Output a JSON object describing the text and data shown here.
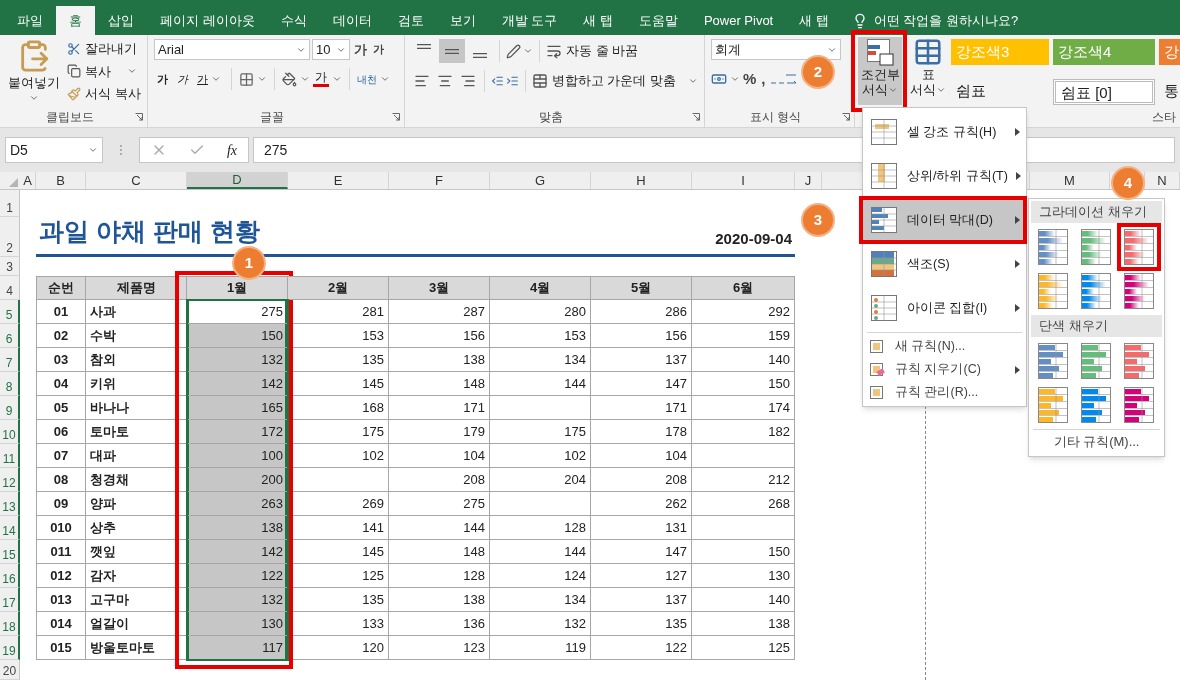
{
  "tabs": [
    {
      "label": "파일",
      "selected": false
    },
    {
      "label": "홈",
      "selected": true
    },
    {
      "label": "삽입",
      "selected": false
    },
    {
      "label": "페이지 레이아웃",
      "selected": false
    },
    {
      "label": "수식",
      "selected": false
    },
    {
      "label": "데이터",
      "selected": false
    },
    {
      "label": "검토",
      "selected": false
    },
    {
      "label": "보기",
      "selected": false
    },
    {
      "label": "개발 도구",
      "selected": false
    },
    {
      "label": "새 탭",
      "selected": false
    },
    {
      "label": "도움말",
      "selected": false
    },
    {
      "label": "Power Pivot",
      "selected": false
    },
    {
      "label": "새 탭",
      "selected": false
    }
  ],
  "tell_me": {
    "placeholder": "어떤 작업을 원하시나요?"
  },
  "ribbon": {
    "clipboard": {
      "paste": "붙여넣기",
      "cut": "잘라내기",
      "copy": "복사",
      "format_painter": "서식 복사",
      "label": "클립보드"
    },
    "font": {
      "name": "Arial",
      "size": "10",
      "grow": "가",
      "shrink": "가",
      "bold": "가",
      "italic": "가",
      "underline": "가",
      "font_color": "가",
      "phonetic": "내천",
      "label": "글꼴"
    },
    "alignment": {
      "vertical": [
        {
          "selected": false
        },
        {
          "selected": true
        },
        {
          "selected": false
        }
      ],
      "horizontal": [
        {
          "selected": false
        },
        {
          "selected": false
        },
        {
          "selected": false
        }
      ],
      "wrap_text": "자동 줄 바꿈",
      "merge": "병합하고 가운데 맞춤",
      "label": "맞춤"
    },
    "number": {
      "format": "회계",
      "percent": "%",
      "comma": ",",
      "label": "표시 형식"
    },
    "styles": {
      "conditional_formatting": {
        "line1": "조건부",
        "line2": "서식",
        "pressed": true,
        "highlighted": true
      },
      "format_as_table": {
        "line1": "표",
        "line2": "서식"
      },
      "cell_styles": [
        {
          "kind": "accent",
          "label": "강조색3",
          "color": "#ffc000"
        },
        {
          "kind": "accent",
          "label": "강조색4",
          "color": "#70ad47"
        },
        {
          "kind": "accent",
          "label": "강",
          "color": "#ed7d31"
        },
        {
          "kind": "plain",
          "label": "쉼표"
        },
        {
          "kind": "current",
          "label": "쉼표 [0]"
        },
        {
          "kind": "plain",
          "label": "통"
        }
      ],
      "label": "스타"
    }
  },
  "formula_bar": {
    "name_box": "D5",
    "function_label": "fx",
    "formula": "275"
  },
  "sheet": {
    "column_headers": [
      {
        "label": "A",
        "selected": false
      },
      {
        "label": "B",
        "selected": false
      },
      {
        "label": "C",
        "selected": false
      },
      {
        "label": "D",
        "selected": true
      },
      {
        "label": "E",
        "selected": false
      },
      {
        "label": "F",
        "selected": false
      },
      {
        "label": "G",
        "selected": false
      },
      {
        "label": "H",
        "selected": false
      },
      {
        "label": "I",
        "selected": false
      },
      {
        "label": "J",
        "selected": false
      },
      {
        "label": "M",
        "selected": false
      },
      {
        "label": "N",
        "selected": false
      }
    ],
    "row_headers": [
      {
        "label": "1",
        "selected": false
      },
      {
        "label": "2",
        "selected": false
      },
      {
        "label": "3",
        "selected": false
      },
      {
        "label": "4",
        "selected": false
      },
      {
        "label": "5",
        "selected": true
      },
      {
        "label": "6",
        "selected": true
      },
      {
        "label": "7",
        "selected": true
      },
      {
        "label": "8",
        "selected": true
      },
      {
        "label": "9",
        "selected": true
      },
      {
        "label": "10",
        "selected": true
      },
      {
        "label": "11",
        "selected": true
      },
      {
        "label": "12",
        "selected": true
      },
      {
        "label": "13",
        "selected": true
      },
      {
        "label": "14",
        "selected": true
      },
      {
        "label": "15",
        "selected": true
      },
      {
        "label": "16",
        "selected": true
      },
      {
        "label": "17",
        "selected": true
      },
      {
        "label": "18",
        "selected": true
      },
      {
        "label": "19",
        "selected": true
      },
      {
        "label": "20",
        "selected": false
      }
    ],
    "title": "과일 야채 판매 현황",
    "date": "2020-09-04",
    "header_cells": [
      {
        "label": "순번",
        "highlighted": false
      },
      {
        "label": "제품명",
        "highlighted": false
      },
      {
        "label": "1월",
        "highlighted": true
      },
      {
        "label": "2월",
        "highlighted": false
      },
      {
        "label": "3월",
        "highlighted": false
      },
      {
        "label": "4월",
        "highlighted": false
      },
      {
        "label": "5월",
        "highlighted": false
      },
      {
        "label": "6월",
        "highlighted": false
      }
    ],
    "rows": [
      {
        "no": "01",
        "name": "사과",
        "cells": [
          {
            "text": "275",
            "selected": true,
            "active": true
          },
          {
            "text": "281",
            "selected": false
          },
          {
            "text": "287",
            "selected": false
          },
          {
            "text": "280",
            "selected": false
          },
          {
            "text": "286",
            "selected": false
          },
          {
            "text": "292",
            "selected": false
          }
        ]
      },
      {
        "no": "02",
        "name": "수박",
        "cells": [
          {
            "text": "150",
            "selected": true,
            "active": false
          },
          {
            "text": "153",
            "selected": false
          },
          {
            "text": "156",
            "selected": false
          },
          {
            "text": "153",
            "selected": false
          },
          {
            "text": "156",
            "selected": false
          },
          {
            "text": "159",
            "selected": false
          }
        ]
      },
      {
        "no": "03",
        "name": "참외",
        "cells": [
          {
            "text": "132",
            "selected": true,
            "active": false
          },
          {
            "text": "135",
            "selected": false
          },
          {
            "text": "138",
            "selected": false
          },
          {
            "text": "134",
            "selected": false
          },
          {
            "text": "137",
            "selected": false
          },
          {
            "text": "140",
            "selected": false
          }
        ]
      },
      {
        "no": "04",
        "name": "키위",
        "cells": [
          {
            "text": "142",
            "selected": true,
            "active": false
          },
          {
            "text": "145",
            "selected": false
          },
          {
            "text": "148",
            "selected": false
          },
          {
            "text": "144",
            "selected": false
          },
          {
            "text": "147",
            "selected": false
          },
          {
            "text": "150",
            "selected": false
          }
        ]
      },
      {
        "no": "05",
        "name": "바나나",
        "cells": [
          {
            "text": "165",
            "selected": true,
            "active": false
          },
          {
            "text": "168",
            "selected": false
          },
          {
            "text": "171",
            "selected": false
          },
          {
            "selected": false
          },
          {
            "text": "171",
            "selected": false
          },
          {
            "text": "174",
            "selected": false
          }
        ]
      },
      {
        "no": "06",
        "name": "토마토",
        "cells": [
          {
            "text": "172",
            "selected": true,
            "active": false
          },
          {
            "text": "175",
            "selected": false
          },
          {
            "text": "179",
            "selected": false
          },
          {
            "text": "175",
            "selected": false
          },
          {
            "text": "178",
            "selected": false
          },
          {
            "text": "182",
            "selected": false
          }
        ]
      },
      {
        "no": "07",
        "name": "대파",
        "cells": [
          {
            "text": "100",
            "selected": true,
            "active": false
          },
          {
            "text": "102",
            "selected": false
          },
          {
            "text": "104",
            "selected": false
          },
          {
            "text": "102",
            "selected": false
          },
          {
            "text": "104",
            "selected": false
          },
          {
            "selected": false
          }
        ]
      },
      {
        "no": "08",
        "name": "청경채",
        "cells": [
          {
            "text": "200",
            "selected": true,
            "active": false
          },
          {
            "selected": false
          },
          {
            "text": "208",
            "selected": false
          },
          {
            "text": "204",
            "selected": false
          },
          {
            "text": "208",
            "selected": false
          },
          {
            "text": "212",
            "selected": false
          }
        ]
      },
      {
        "no": "09",
        "name": "양파",
        "cells": [
          {
            "text": "263",
            "selected": true,
            "active": false
          },
          {
            "text": "269",
            "selected": false
          },
          {
            "text": "275",
            "selected": false
          },
          {
            "selected": false
          },
          {
            "text": "262",
            "selected": false
          },
          {
            "text": "268",
            "selected": false
          }
        ]
      },
      {
        "no": "010",
        "name": "상추",
        "cells": [
          {
            "text": "138",
            "selected": true,
            "active": false
          },
          {
            "text": "141",
            "selected": false
          },
          {
            "text": "144",
            "selected": false
          },
          {
            "text": "128",
            "selected": false
          },
          {
            "text": "131",
            "selected": false
          },
          {
            "selected": false
          }
        ]
      },
      {
        "no": "011",
        "name": "깻잎",
        "cells": [
          {
            "text": "142",
            "selected": true,
            "active": false
          },
          {
            "text": "145",
            "selected": false
          },
          {
            "text": "148",
            "selected": false
          },
          {
            "text": "144",
            "selected": false
          },
          {
            "text": "147",
            "selected": false
          },
          {
            "text": "150",
            "selected": false
          }
        ]
      },
      {
        "no": "012",
        "name": "감자",
        "cells": [
          {
            "text": "122",
            "selected": true,
            "active": false
          },
          {
            "text": "125",
            "selected": false
          },
          {
            "text": "128",
            "selected": false
          },
          {
            "text": "124",
            "selected": false
          },
          {
            "text": "127",
            "selected": false
          },
          {
            "text": "130",
            "selected": false
          }
        ]
      },
      {
        "no": "013",
        "name": "고구마",
        "cells": [
          {
            "text": "132",
            "selected": true,
            "active": false
          },
          {
            "text": "135",
            "selected": false
          },
          {
            "text": "138",
            "selected": false
          },
          {
            "text": "134",
            "selected": false
          },
          {
            "text": "137",
            "selected": false
          },
          {
            "text": "140",
            "selected": false
          }
        ]
      },
      {
        "no": "014",
        "name": "얼갈이",
        "cells": [
          {
            "text": "130",
            "selected": true,
            "active": false
          },
          {
            "text": "133",
            "selected": false
          },
          {
            "text": "136",
            "selected": false
          },
          {
            "text": "132",
            "selected": false
          },
          {
            "text": "135",
            "selected": false
          },
          {
            "text": "138",
            "selected": false
          }
        ]
      },
      {
        "no": "015",
        "name": "방울토마토",
        "cells": [
          {
            "text": "117",
            "selected": true,
            "active": false
          },
          {
            "text": "120",
            "selected": false
          },
          {
            "text": "123",
            "selected": false
          },
          {
            "text": "119",
            "selected": false
          },
          {
            "text": "122",
            "selected": false
          },
          {
            "text": "125",
            "selected": false
          }
        ]
      }
    ]
  },
  "menu": {
    "items": [
      {
        "kind": "rule",
        "label": "셀 강조 규칙(H)",
        "submenu": true,
        "selected": false,
        "highlighted": false
      },
      {
        "kind": "rule",
        "label": "상위/하위 규칙(T)",
        "submenu": true,
        "selected": false,
        "highlighted": false
      },
      {
        "kind": "rule",
        "label": "데이터 막대(D)",
        "submenu": true,
        "selected": true,
        "highlighted": true
      },
      {
        "kind": "rule",
        "label": "색조(S)",
        "submenu": true,
        "selected": false,
        "highlighted": false
      },
      {
        "kind": "rule",
        "label": "아이콘 집합(I)",
        "submenu": true,
        "selected": false,
        "highlighted": false
      },
      {
        "kind": "command",
        "label": "새 규칙(N)...",
        "submenu": false,
        "selected": false,
        "highlighted": false
      },
      {
        "kind": "command",
        "label": "규칙 지우기(C)",
        "submenu": true,
        "selected": false,
        "highlighted": false
      },
      {
        "kind": "command",
        "label": "규칙 관리(R)...",
        "submenu": false,
        "selected": false,
        "highlighted": false
      }
    ]
  },
  "submenu": {
    "sections": [
      {
        "title": "그라데이션 채우기",
        "kind": "gradient",
        "swatches": [
          {
            "color": "#638ec6",
            "highlighted": false
          },
          {
            "color": "#63be7b",
            "highlighted": false
          },
          {
            "color": "#f8696b",
            "highlighted": true
          },
          {
            "color": "#ffb628",
            "highlighted": false
          },
          {
            "color": "#008aef",
            "highlighted": false
          },
          {
            "color": "#d6007b",
            "highlighted": false
          }
        ]
      },
      {
        "title": "단색 채우기",
        "kind": "solid",
        "swatches": [
          {
            "color": "#638ec6",
            "highlighted": false
          },
          {
            "color": "#63be7b",
            "highlighted": false
          },
          {
            "color": "#f8696b",
            "highlighted": false
          },
          {
            "color": "#ffb628",
            "highlighted": false
          },
          {
            "color": "#008aef",
            "highlighted": false
          },
          {
            "color": "#d6007b",
            "highlighted": false
          }
        ]
      }
    ],
    "more": "기타 규칙(M)..."
  },
  "callouts": [
    {
      "number": "1"
    },
    {
      "number": "2"
    },
    {
      "number": "3"
    },
    {
      "number": "4"
    }
  ]
}
